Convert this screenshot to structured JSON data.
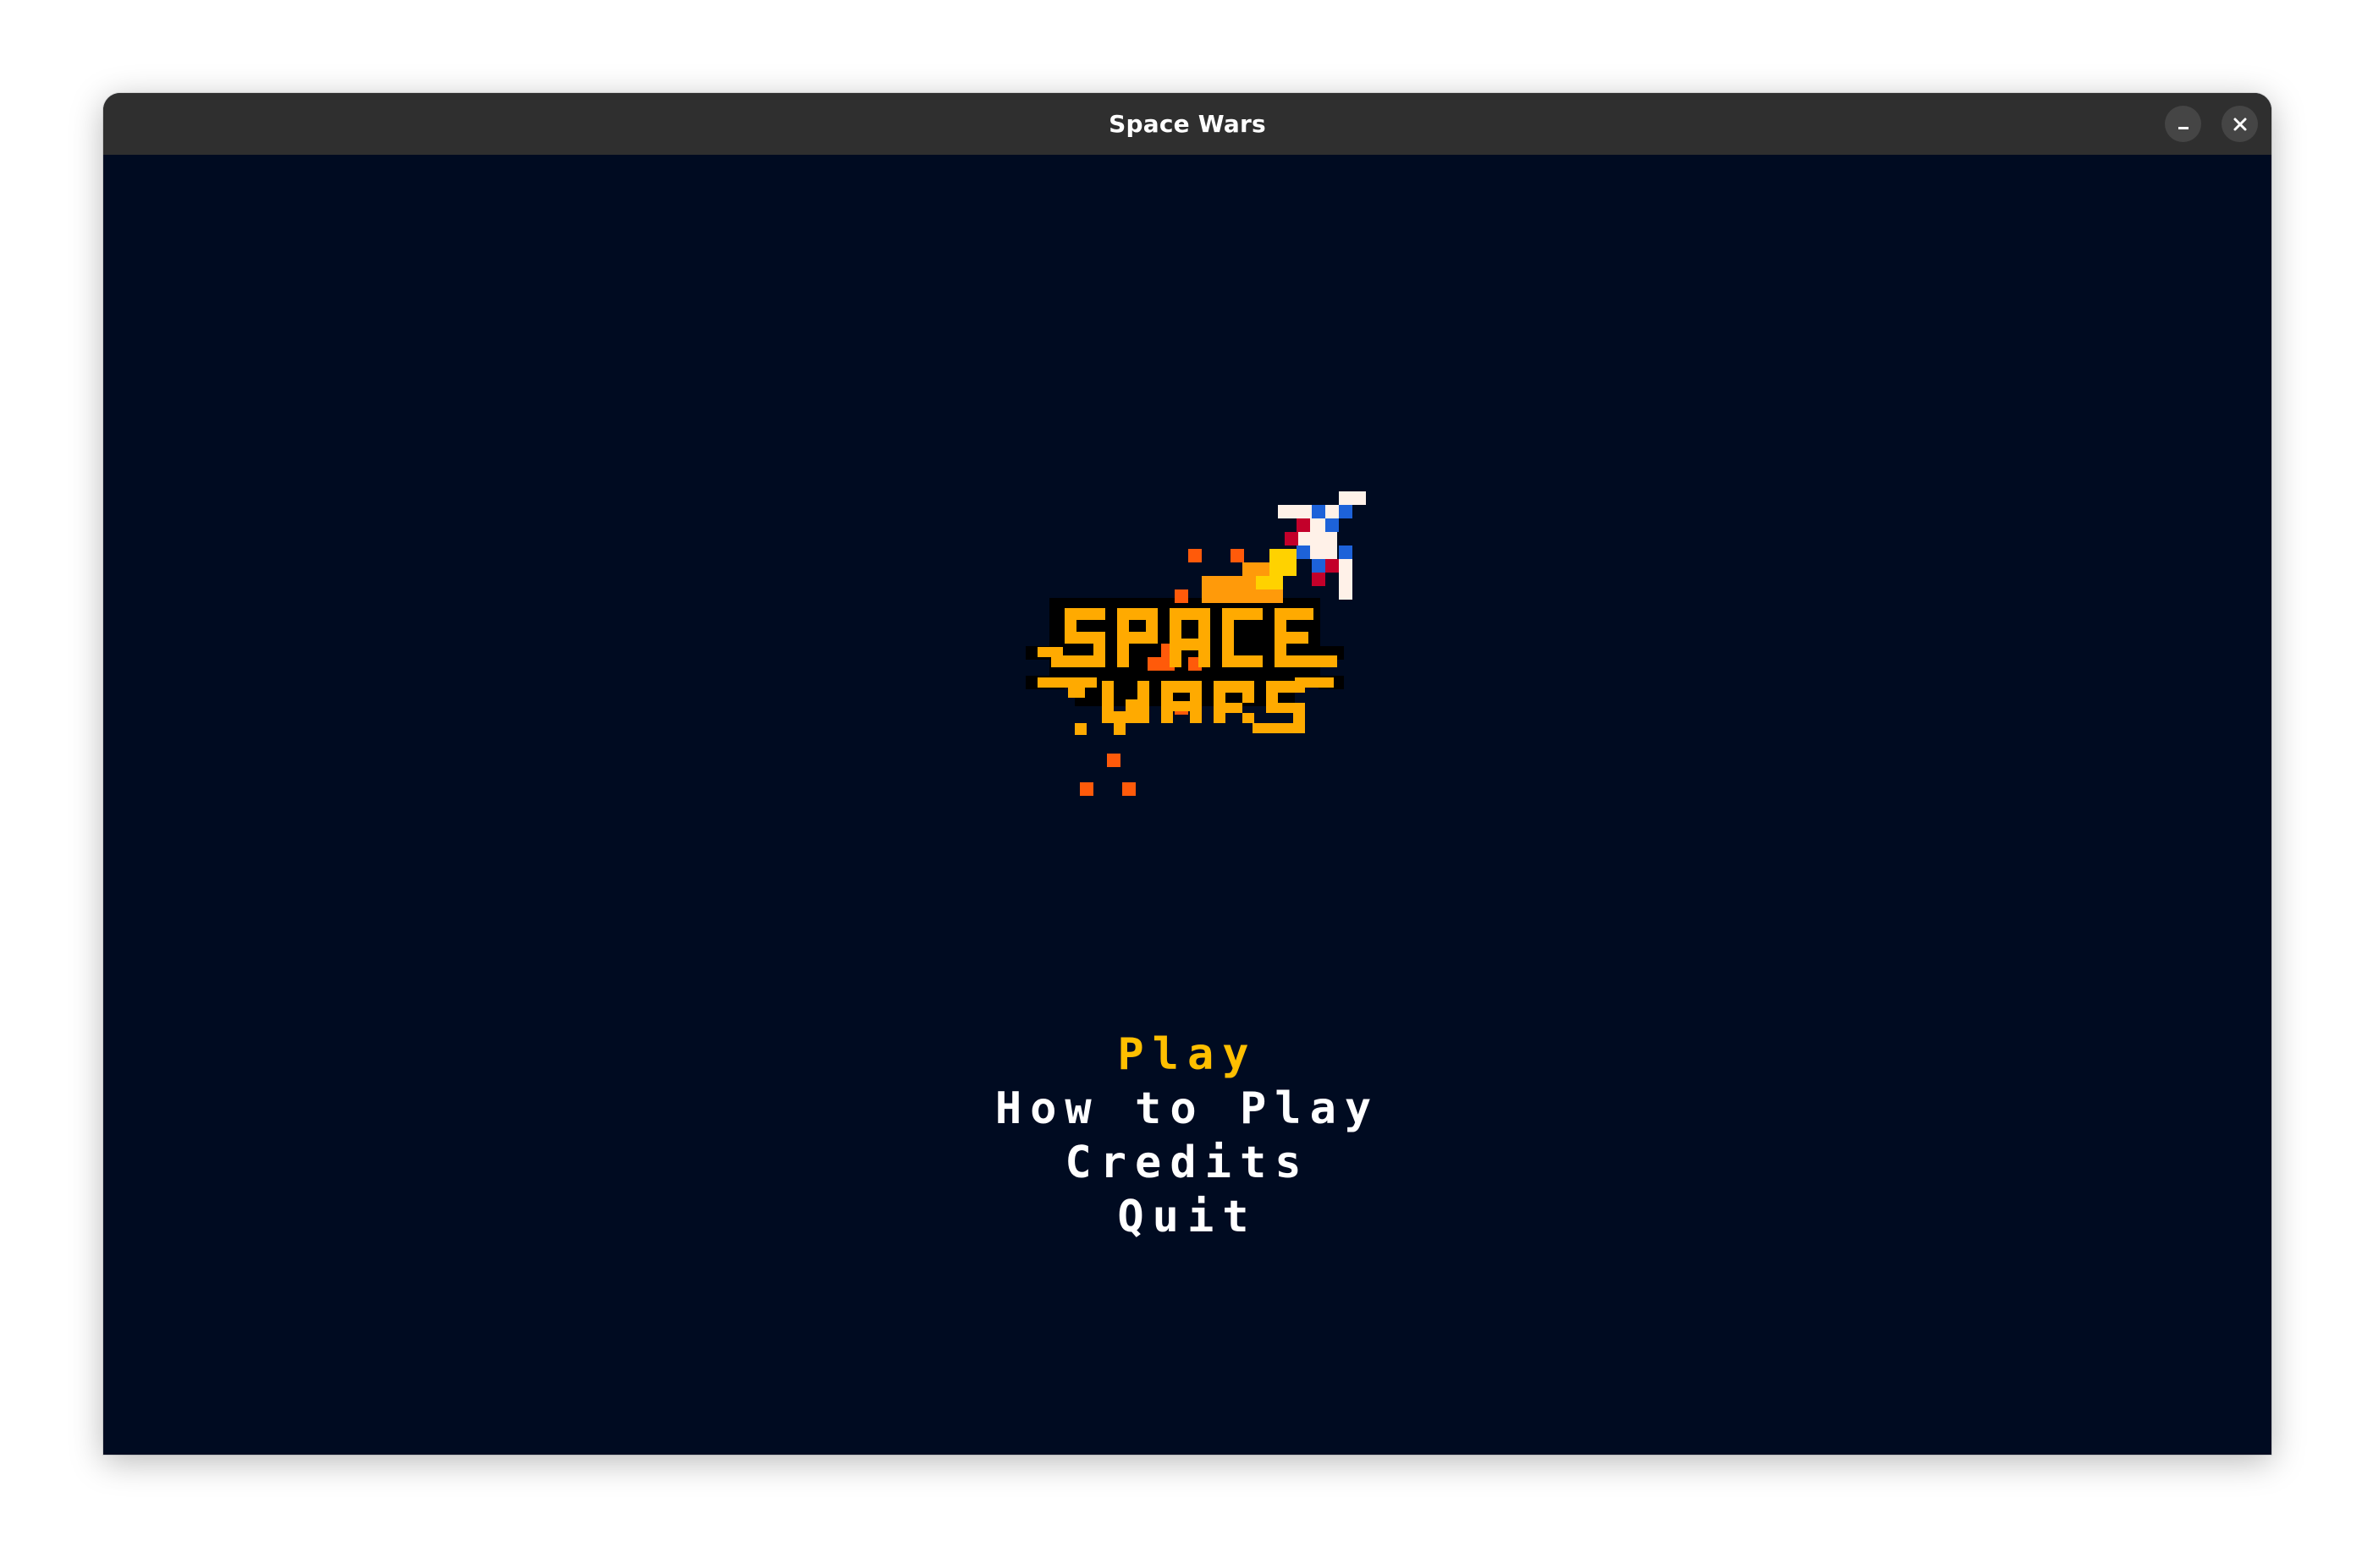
{
  "window": {
    "title": "Space Wars",
    "minimize_icon": "minimize-icon",
    "close_icon": "close-icon"
  },
  "game": {
    "logo": {
      "line1": "SPACE",
      "line2": "WARS",
      "icon": "spaceship-icon"
    },
    "menu": {
      "items": [
        {
          "label": "Play",
          "selected": true
        },
        {
          "label": "How to Play",
          "selected": false
        },
        {
          "label": "Credits",
          "selected": false
        },
        {
          "label": "Quit",
          "selected": false
        }
      ]
    }
  },
  "colors": {
    "background": "#000b21",
    "titlebar": "#2f2f2f",
    "menu_selected": "#ffbf00",
    "menu_default": "#ffffff",
    "logo_primary": "#ffaa00",
    "logo_flame": "#ff5a0a",
    "ship_body": "#fff1e8",
    "ship_blue": "#1d62d9",
    "ship_red": "#c3002a"
  }
}
